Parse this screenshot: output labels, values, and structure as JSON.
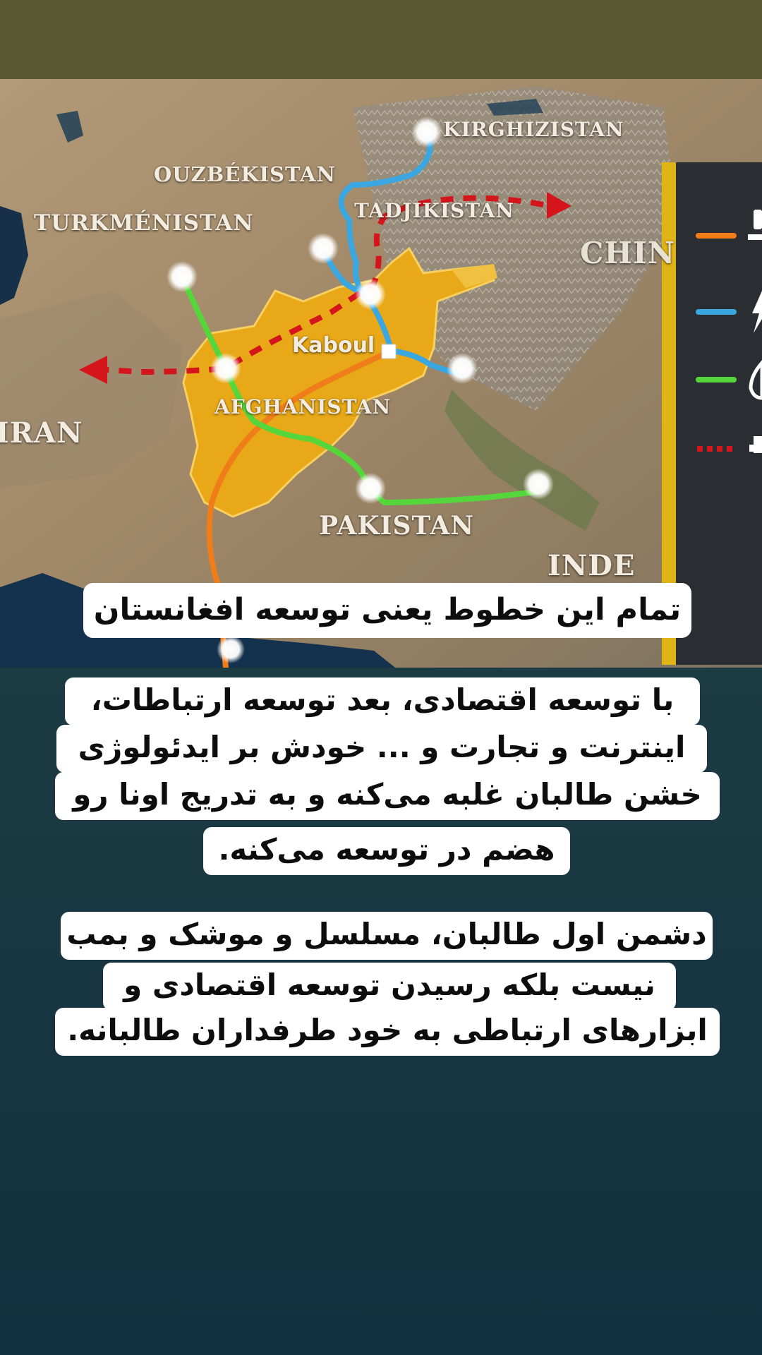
{
  "map": {
    "labels": {
      "kirghizistan": "KIRGHIZISTAN",
      "ouzbekistan": "OUZBÉKISTAN",
      "tadjikistan": "TADJIKISTAN",
      "turkmenistan": "TURKMÉNISTAN",
      "chine": "CHIN",
      "kaboul": "Kaboul",
      "afghanistan": "AFGHANISTAN",
      "iran": "IRAN",
      "pakistan": "PAKISTAN",
      "inde": "INDE"
    },
    "colors": {
      "afghanistan_fill": "#e8a817",
      "railway_orange": "#ef7d1a",
      "route_blue": "#3aa7e0",
      "route_green": "#55d63a",
      "planned_red": "#d4151b",
      "legend_bar": "#e0b416",
      "legend_bg": "#2a2e33"
    },
    "legend_icons": [
      "train-icon",
      "bolt-icon",
      "gas-icon",
      "truck-icon"
    ]
  },
  "captions": {
    "map_caption": "تمام این خطوط یعنی توسعه افغانستان",
    "paragraph1": [
      "با توسعه اقتصادی، بعد توسعه ارتباطات،",
      "اینترنت و تجارت و ... خودش بر ایدئولوژی",
      "خشن طالبان غلبه می‌کنه و به تدریج اونا رو",
      "هضم در توسعه می‌کنه."
    ],
    "paragraph2": [
      "دشمن اول طالبان، مسلسل و موشک و بمب",
      "نیست بلکه رسیدن توسعه اقتصادی و",
      "ابزارهای ارتباطی به خود طرفداران طالبانه."
    ]
  }
}
